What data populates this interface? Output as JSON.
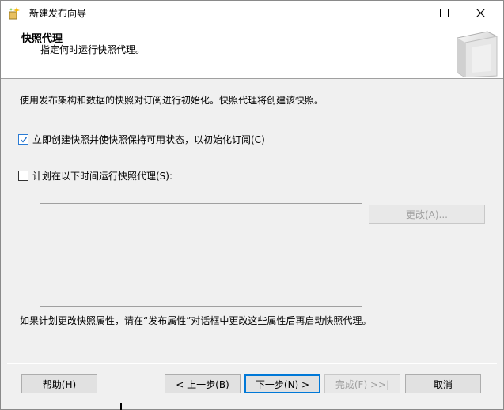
{
  "window": {
    "title": "新建发布向导"
  },
  "header": {
    "title": "快照代理",
    "subtitle": "指定何时运行快照代理。"
  },
  "main": {
    "description": "使用发布架构和数据的快照对订阅进行初始化。快照代理将创建该快照。",
    "option_immediate": {
      "label": "立即创建快照并使快照保持可用状态，以初始化订阅(C)",
      "checked": true
    },
    "option_schedule": {
      "label": "计划在以下时间运行快照代理(S):",
      "checked": false
    },
    "schedule_text": "",
    "change_button": "更改(A)...",
    "note": "如果计划更改快照属性，请在“发布属性”对话框中更改这些属性后再启动快照代理。"
  },
  "footer": {
    "help": "帮助(H)",
    "prev": "< 上一步(B)",
    "next": "下一步(N) >",
    "finish": "完成(F) >>|",
    "cancel": "取消"
  },
  "colors": {
    "accent": "#0078d7",
    "checkbox_accent": "#2a7bd4"
  }
}
